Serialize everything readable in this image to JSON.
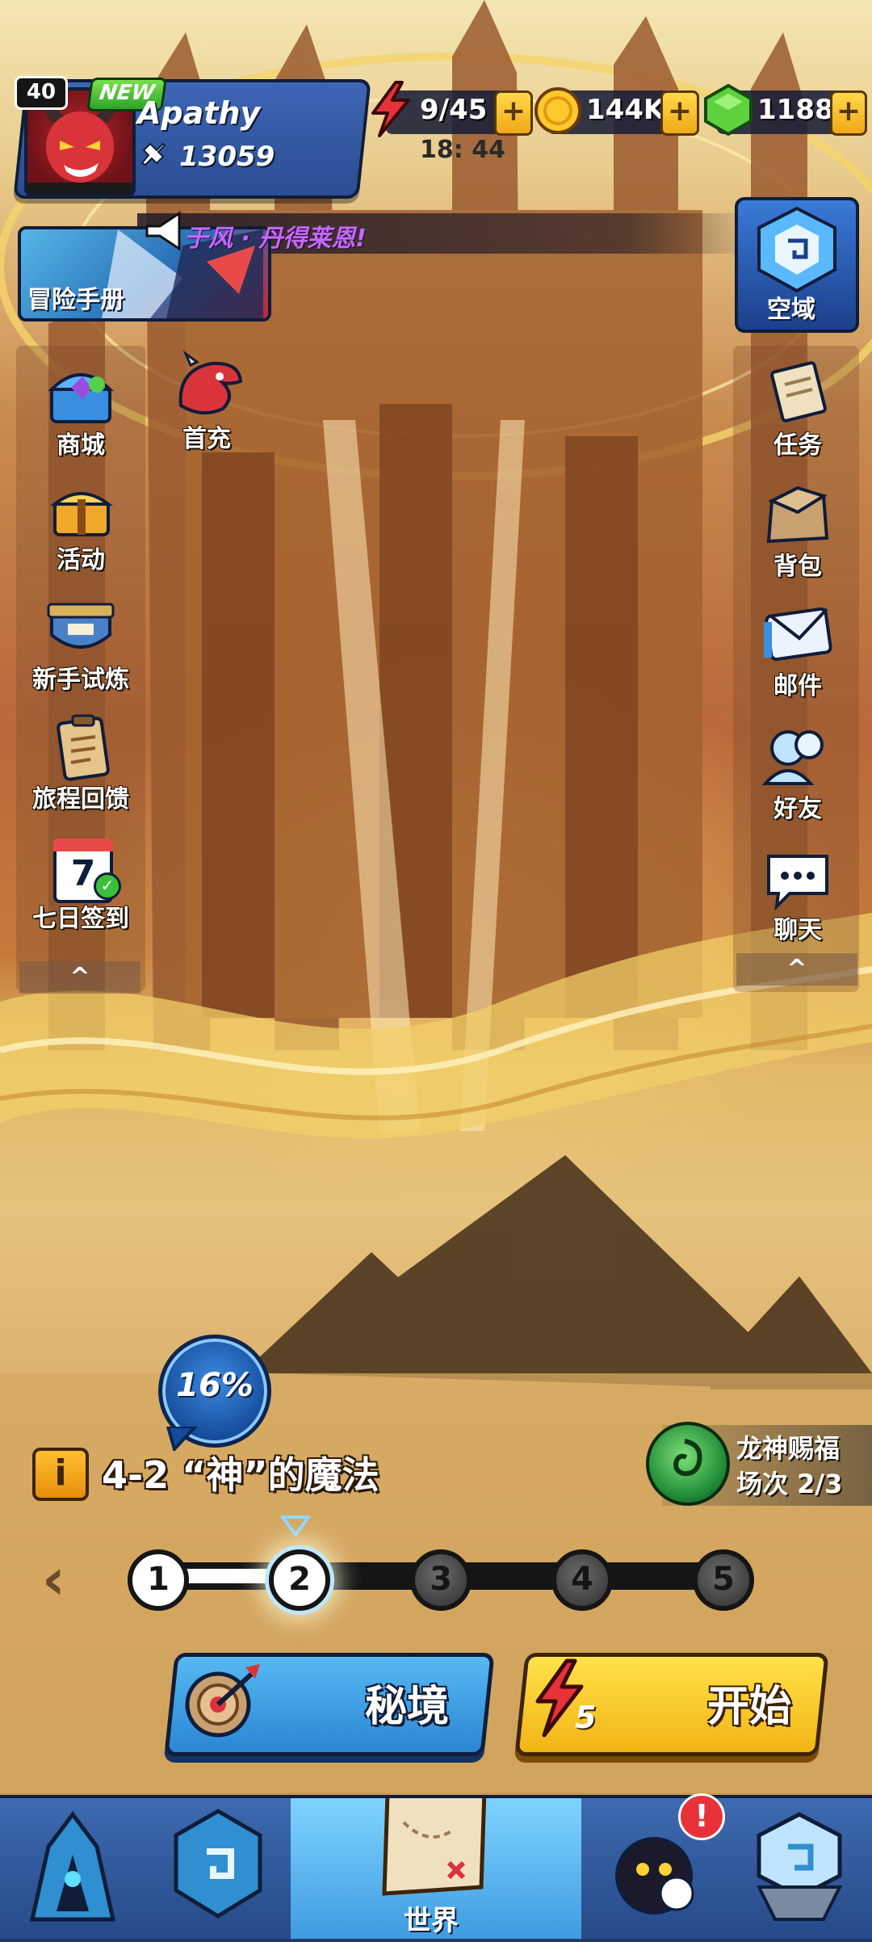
{
  "player": {
    "level": "40",
    "new_tag": "NEW",
    "name": "Apathy",
    "power": "13059"
  },
  "resources": {
    "energy": "9/45",
    "energy_timer": "18: 44",
    "gold": "144K",
    "gems": "1188",
    "plus": "+"
  },
  "notice": {
    "text": "于风 · 丹得莱恩!"
  },
  "handbook": {
    "label": "冒险手册"
  },
  "domain": {
    "label": "空域"
  },
  "left_menu": {
    "shop": "商城",
    "first_recharge": "首充",
    "events": "活动",
    "novice_trial": "新手试炼",
    "journey_feedback": "旅程回馈",
    "seven_day": "七日签到",
    "seven_day_num": "7",
    "collapse": "^"
  },
  "right_menu": {
    "tasks": "任务",
    "bag": "背包",
    "mail": "邮件",
    "friends": "好友",
    "chat": "聊天",
    "collapse": "^"
  },
  "stage": {
    "progress": "16%",
    "info_icon": "i",
    "title": "4-2 “神”的魔法",
    "nodes": [
      "1",
      "2",
      "3",
      "4",
      "5"
    ],
    "current_node": 2,
    "nav_left": "‹"
  },
  "blessing": {
    "line1": "龙神赐福",
    "line2": "场次 2/3"
  },
  "actions": {
    "secret_realm": "秘境",
    "start": "开始",
    "start_cost": "5"
  },
  "bottom_nav": {
    "active_label": "世界",
    "alert": "!"
  },
  "colors": {
    "primary_blue": "#2a86d4",
    "gold": "#f2b414",
    "notice_purple": "#c667ff",
    "navy_outline": "#0f1d3a"
  }
}
